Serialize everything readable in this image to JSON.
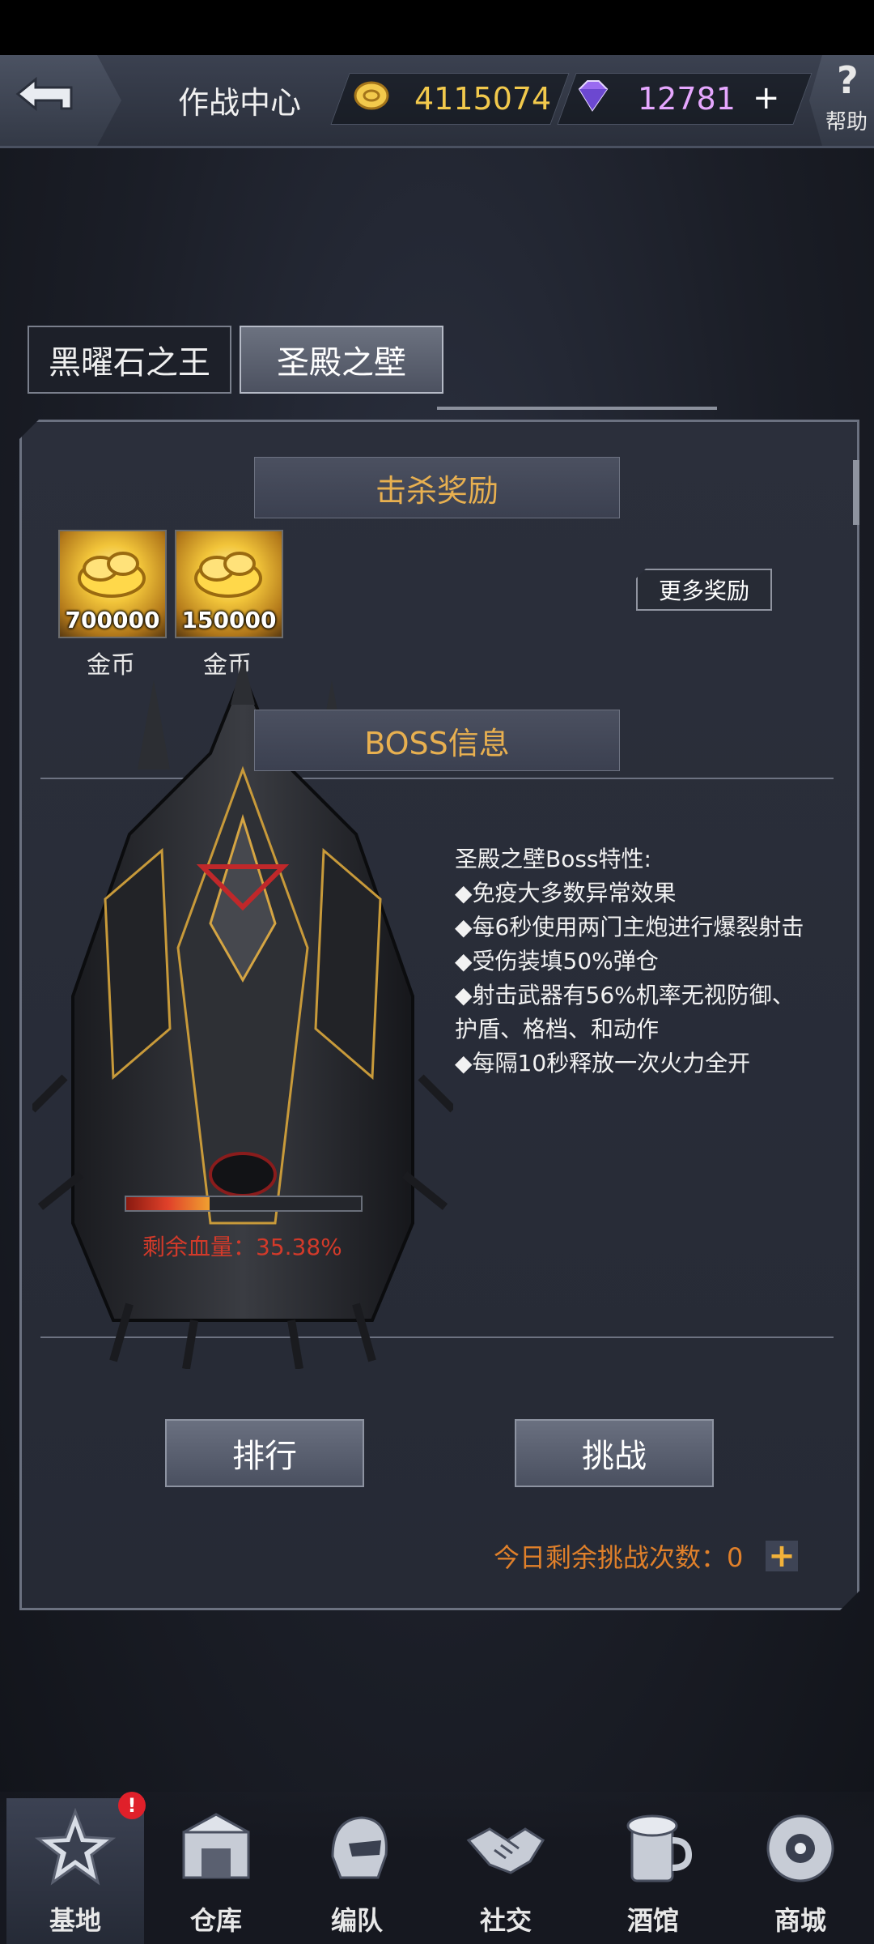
{
  "header": {
    "title": "作战中心",
    "gold_amount": "4115074",
    "gem_amount": "12781",
    "help_label": "帮助"
  },
  "tabs": [
    {
      "label": "黑曜石之王",
      "active": false
    },
    {
      "label": "圣殿之壁",
      "active": true
    }
  ],
  "kill_rewards": {
    "title": "击杀奖励",
    "items": [
      {
        "amount": "700000",
        "label": "金币",
        "icon": "gold-coin-pile-icon"
      },
      {
        "amount": "150000",
        "label": "金币",
        "icon": "gold-coin-pile-icon"
      }
    ],
    "more_label": "更多奖励"
  },
  "boss_info": {
    "title": "BOSS信息",
    "traits_title": "圣殿之壁Boss特性:",
    "traits": [
      "◆免疫大多数异常效果",
      "◆每6秒使用两门主炮进行爆裂射击",
      "◆受伤装填50%弹仓",
      "◆射击武器有56%机率无视防御、护盾、格档、和动作",
      "◆每隔10秒释放一次火力全开"
    ],
    "hp_fraction": 0.3538,
    "hp_text": "剩余血量：35.38%"
  },
  "actions": {
    "rank_label": "排行",
    "challenge_label": "挑战",
    "remaining_text": "今日剩余挑战次数：0"
  },
  "nav": [
    {
      "label": "基地",
      "icon": "base-star-icon",
      "active": true,
      "badge": "!"
    },
    {
      "label": "仓库",
      "icon": "warehouse-icon"
    },
    {
      "label": "编队",
      "icon": "formation-helmet-icon"
    },
    {
      "label": "社交",
      "icon": "handshake-icon"
    },
    {
      "label": "酒馆",
      "icon": "tavern-mug-icon"
    },
    {
      "label": "商城",
      "icon": "shop-robot-icon"
    }
  ],
  "colors": {
    "accent_gold": "#e8b050",
    "hp_red": "#d23a2a",
    "remaining_orange": "#e0802a"
  }
}
